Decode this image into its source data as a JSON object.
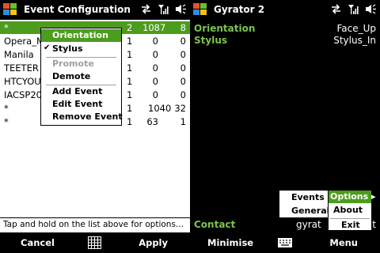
{
  "left": {
    "title": "Event Configuration",
    "rows": [
      {
        "name": "*",
        "a": "2",
        "b": "1087",
        "c": "8"
      },
      {
        "name": "Opera_M",
        "a": "1",
        "b": "0",
        "c": "0"
      },
      {
        "name": "Manila",
        "a": "1",
        "b": "0",
        "c": "0"
      },
      {
        "name": "TEETER",
        "a": "1",
        "b": "0",
        "c": "0"
      },
      {
        "name": "HTCYOU",
        "a": "1",
        "b": "0",
        "c": "0"
      },
      {
        "name": "IACSP20",
        "a": "1",
        "b": "0",
        "c": "0"
      },
      {
        "name": "*",
        "a": "1",
        "b": "1040",
        "c": "32"
      },
      {
        "name": "*",
        "a": "1",
        "b": "63",
        "c": "1"
      }
    ],
    "context_menu": {
      "orientation": "Orientation",
      "stylus": "Stylus",
      "check": "✔",
      "promote": "Promote",
      "demote": "Demote",
      "add_event": "Add Event",
      "edit_event": "Edit Event",
      "remove_event": "Remove Event"
    },
    "hint": "Tap and hold on the list above for options...",
    "softkey_left": "Cancel",
    "softkey_right": "Apply"
  },
  "right": {
    "title": "Gyrator 2",
    "rows": [
      {
        "label": "Orientation",
        "value": "Face_Up"
      },
      {
        "label": "Stylus",
        "value": "Stylus_In"
      }
    ],
    "contact_label": "Contact",
    "contact_value": "gyrat",
    "contact_tail": "t",
    "submenu": {
      "events": "Events",
      "general": "General"
    },
    "menu": {
      "options": "Options ▸",
      "about": "About",
      "exit": "Exit"
    },
    "softkey_left": "Minimise",
    "softkey_right": "Menu"
  },
  "colors": {
    "highlight": "#4c9c1e",
    "label_green": "#7ec24a"
  }
}
